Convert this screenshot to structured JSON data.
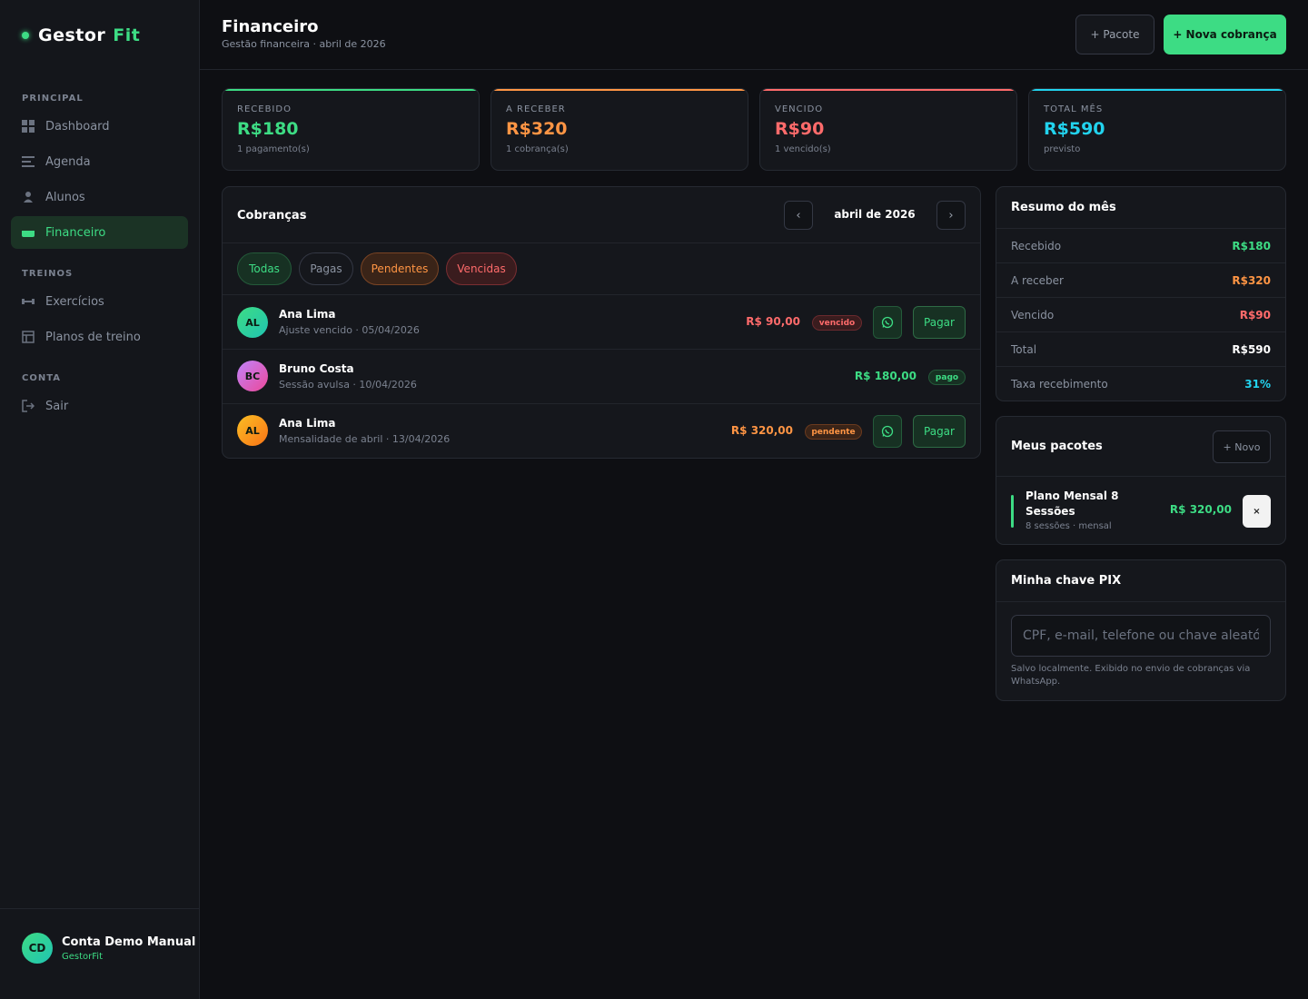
{
  "brand": {
    "name": "Gestor",
    "accent": "Fit"
  },
  "sidebar": {
    "sections": [
      {
        "label": "PRINCIPAL"
      },
      {
        "label": "TREINOS"
      },
      {
        "label": "CONTA"
      }
    ],
    "items": [
      {
        "label": "Dashboard",
        "icon": "grid-icon"
      },
      {
        "label": "Agenda",
        "icon": "lines-icon"
      },
      {
        "label": "Alunos",
        "icon": "user-icon"
      },
      {
        "label": "Financeiro",
        "icon": "wallet-icon",
        "active": true
      },
      {
        "label": "Exercícios",
        "icon": "dumbbell-icon"
      },
      {
        "label": "Planos de treino",
        "icon": "table-icon"
      },
      {
        "label": "Sair",
        "icon": "logout-icon"
      }
    ],
    "account": {
      "initials": "CD",
      "name": "Conta Demo Manual",
      "sub": "GestorFit"
    }
  },
  "header": {
    "title": "Financeiro",
    "subtitle": "Gestão financeira · abril de 2026",
    "btn_pacote": "+ Pacote",
    "btn_cobranca": "+ Nova cobrança"
  },
  "kpis": [
    {
      "label": "RECEBIDO",
      "value": "R$180",
      "sub": "1 pagamento(s)",
      "color": "#3ddc84"
    },
    {
      "label": "A RECEBER",
      "value": "R$320",
      "sub": "1 cobrança(s)",
      "color": "#ff9544"
    },
    {
      "label": "VENCIDO",
      "value": "R$90",
      "sub": "1 vencido(s)",
      "color": "#ff6b6b"
    },
    {
      "label": "TOTAL MÊS",
      "value": "R$590",
      "sub": "previsto",
      "color": "#22d3ee"
    }
  ],
  "cobrancas": {
    "title": "Cobranças",
    "month": "abril de 2026",
    "filters": [
      "Todas",
      "Pagas",
      "Pendentes",
      "Vencidas"
    ],
    "rows": [
      {
        "initials": "AL",
        "name": "Ana Lima",
        "desc": "Ajuste vencido · 05/04/2026",
        "amount": "R$ 90,00",
        "status": "vencido",
        "action": "Pagar"
      },
      {
        "initials": "BC",
        "name": "Bruno Costa",
        "desc": "Sessão avulsa · 10/04/2026",
        "amount": "R$ 180,00",
        "status": "pago",
        "action": ""
      },
      {
        "initials": "AL",
        "name": "Ana Lima",
        "desc": "Mensalidade de abril · 13/04/2026",
        "amount": "R$ 320,00",
        "status": "pendente",
        "action": "Pagar"
      }
    ]
  },
  "resumo": {
    "title": "Resumo do mês",
    "rows": [
      {
        "label": "Recebido",
        "value": "R$180",
        "color": "#3ddc84"
      },
      {
        "label": "A receber",
        "value": "R$320",
        "color": "#ff9544"
      },
      {
        "label": "Vencido",
        "value": "R$90",
        "color": "#ff6b6b"
      },
      {
        "label": "Total",
        "value": "R$590",
        "color": "#ffffff"
      },
      {
        "label": "Taxa recebimento",
        "value": "31%",
        "color": "#22d3ee"
      }
    ]
  },
  "pacotes": {
    "title": "Meus pacotes",
    "btn_novo": "+ Novo",
    "item": {
      "name": "Plano Mensal 8 Sessões",
      "sub": "8 sessões · mensal",
      "price": "R$ 320,00",
      "remove": "×"
    }
  },
  "pix": {
    "title": "Minha chave PIX",
    "placeholder": "CPF, e-mail, telefone ou chave aleatória",
    "note": "Salvo localmente. Exibido no envio de cobranças via WhatsApp."
  }
}
